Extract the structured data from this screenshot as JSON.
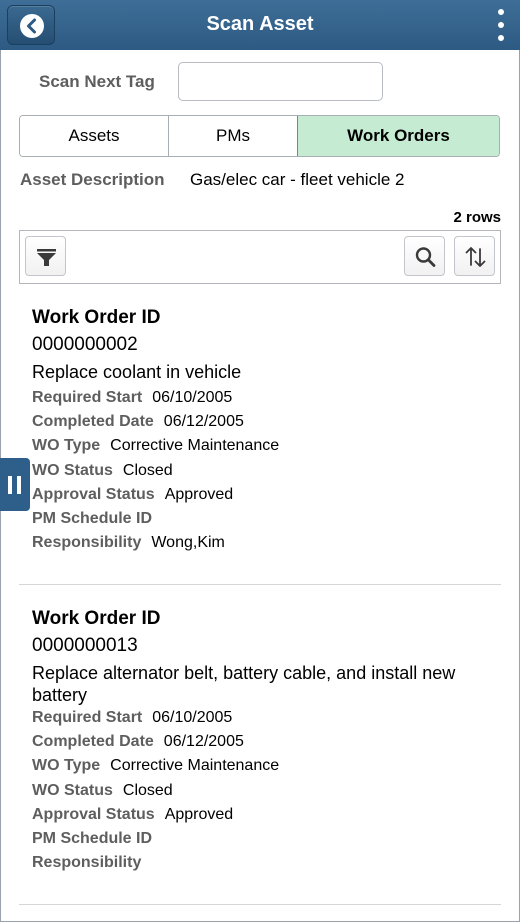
{
  "header": {
    "title": "Scan Asset",
    "back_icon": "back-arrow-icon",
    "menu_icon": "kebab-menu-icon",
    "bar_color": "#2d5a83"
  },
  "scan": {
    "label": "Scan Next Tag",
    "value": "",
    "placeholder": ""
  },
  "tabs": [
    {
      "label": "Assets",
      "active": false
    },
    {
      "label": "PMs",
      "active": false
    },
    {
      "label": "Work Orders",
      "active": true
    }
  ],
  "asset": {
    "label": "Asset Description",
    "value": "Gas/elec car - fleet vehicle 2"
  },
  "grid": {
    "row_count": "2 rows",
    "filter_icon": "filter-icon",
    "search_icon": "search-icon",
    "sort_icon": "sort-icon"
  },
  "side_tab_icon": "pause-icon",
  "work_orders": [
    {
      "title": "Work Order ID",
      "id": "0000000002",
      "description": "Replace coolant in vehicle",
      "fields": [
        {
          "label": "Required Start",
          "value": "06/10/2005"
        },
        {
          "label": "Completed Date",
          "value": "06/12/2005"
        },
        {
          "label": "WO Type",
          "value": "Corrective Maintenance"
        },
        {
          "label": "WO Status",
          "value": "Closed"
        },
        {
          "label": "Approval Status",
          "value": "Approved"
        },
        {
          "label": "PM Schedule ID",
          "value": ""
        },
        {
          "label": "Responsibility",
          "value": "Wong,Kim"
        }
      ]
    },
    {
      "title": "Work Order ID",
      "id": "0000000013",
      "description": "Replace alternator belt, battery cable, and install new battery",
      "fields": [
        {
          "label": "Required Start",
          "value": "06/10/2005"
        },
        {
          "label": "Completed Date",
          "value": "06/12/2005"
        },
        {
          "label": "WO Type",
          "value": "Corrective Maintenance"
        },
        {
          "label": "WO Status",
          "value": "Closed"
        },
        {
          "label": "Approval Status",
          "value": "Approved"
        },
        {
          "label": "PM Schedule ID",
          "value": ""
        },
        {
          "label": "Responsibility",
          "value": ""
        }
      ]
    }
  ]
}
